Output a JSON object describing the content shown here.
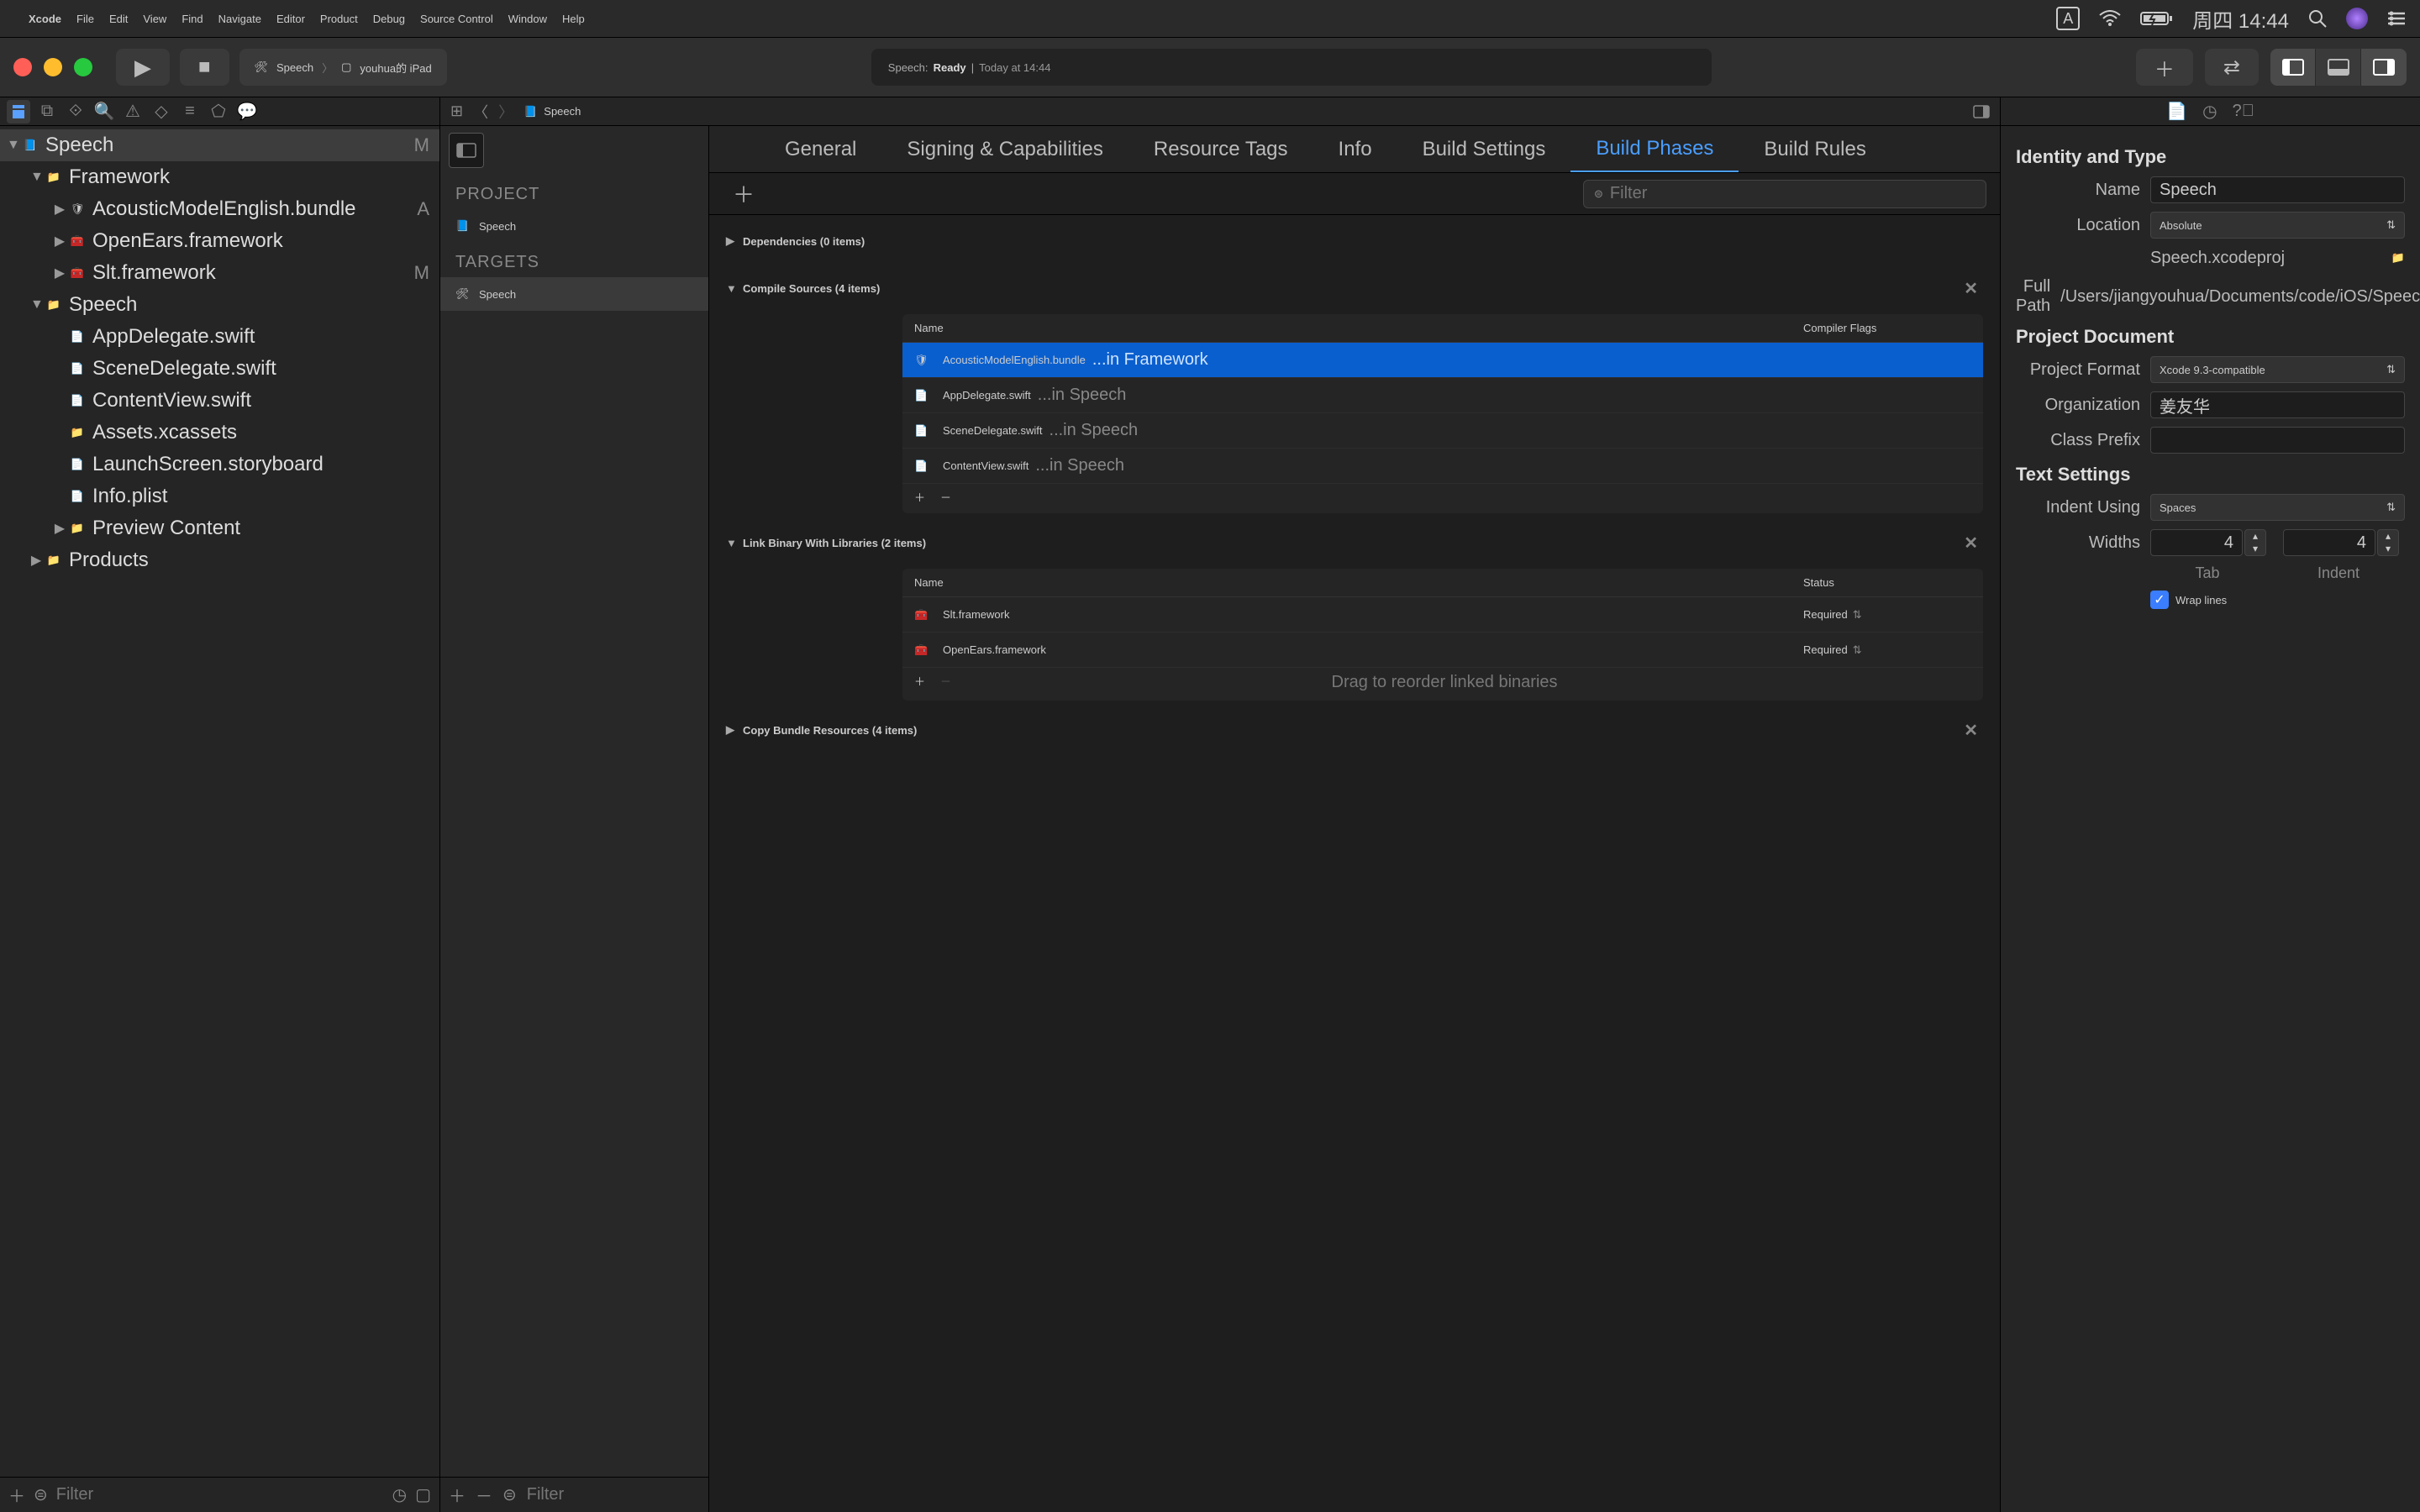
{
  "menubar": {
    "app": "Xcode",
    "items": [
      "File",
      "Edit",
      "View",
      "Find",
      "Navigate",
      "Editor",
      "Product",
      "Debug",
      "Source Control",
      "Window",
      "Help"
    ],
    "clock": "周四 14:44"
  },
  "toolbar": {
    "scheme_app": "Speech",
    "scheme_device": "youhua的 iPad",
    "status_prefix": "Speech:",
    "status_ready": "Ready",
    "status_sep": "|",
    "status_time": "Today at 14:44"
  },
  "navigator": {
    "root": {
      "name": "Speech",
      "badge": "M"
    },
    "tree": [
      {
        "indent": 1,
        "arrow": "▼",
        "icon": "folder",
        "name": "Framework"
      },
      {
        "indent": 2,
        "arrow": "▶",
        "icon": "bundle",
        "name": "AcousticModelEnglish.bundle",
        "badge": "A"
      },
      {
        "indent": 2,
        "arrow": "▶",
        "icon": "fw",
        "name": "OpenEars.framework"
      },
      {
        "indent": 2,
        "arrow": "▶",
        "icon": "fw",
        "name": "Slt.framework",
        "badge": "M"
      },
      {
        "indent": 1,
        "arrow": "▼",
        "icon": "folder",
        "name": "Speech"
      },
      {
        "indent": 2,
        "arrow": "",
        "icon": "swift",
        "name": "AppDelegate.swift"
      },
      {
        "indent": 2,
        "arrow": "",
        "icon": "swift",
        "name": "SceneDelegate.swift"
      },
      {
        "indent": 2,
        "arrow": "",
        "icon": "swift",
        "name": "ContentView.swift"
      },
      {
        "indent": 2,
        "arrow": "",
        "icon": "assets",
        "name": "Assets.xcassets"
      },
      {
        "indent": 2,
        "arrow": "",
        "icon": "storyboard",
        "name": "LaunchScreen.storyboard"
      },
      {
        "indent": 2,
        "arrow": "",
        "icon": "plist",
        "name": "Info.plist"
      },
      {
        "indent": 2,
        "arrow": "▶",
        "icon": "folder",
        "name": "Preview Content"
      },
      {
        "indent": 1,
        "arrow": "▶",
        "icon": "folder",
        "name": "Products"
      }
    ],
    "filter_placeholder": "Filter"
  },
  "jumpbar": {
    "breadcrumb": "Speech"
  },
  "targets": {
    "project_hdr": "PROJECT",
    "project": "Speech",
    "targets_hdr": "TARGETS",
    "target": "Speech"
  },
  "tabs": [
    "General",
    "Signing & Capabilities",
    "Resource Tags",
    "Info",
    "Build Settings",
    "Build Phases",
    "Build Rules"
  ],
  "active_tab": 5,
  "phase_filter_placeholder": "Filter",
  "phases": {
    "dependencies": {
      "title": "Dependencies (0 items)"
    },
    "compile": {
      "title": "Compile Sources (4 items)",
      "col1": "Name",
      "col2": "Compiler Flags",
      "rows": [
        {
          "file": "AcousticModelEnglish.bundle",
          "loc": "...in Framework",
          "sel": true,
          "icon": "bundle"
        },
        {
          "file": "AppDelegate.swift",
          "loc": "...in Speech",
          "icon": "swift"
        },
        {
          "file": "SceneDelegate.swift",
          "loc": "...in Speech",
          "icon": "swift"
        },
        {
          "file": "ContentView.swift",
          "loc": "...in Speech",
          "icon": "swift"
        }
      ]
    },
    "link": {
      "title": "Link Binary With Libraries (2 items)",
      "col1": "Name",
      "col2": "Status",
      "rows": [
        {
          "file": "Slt.framework",
          "status": "Required",
          "icon": "fw"
        },
        {
          "file": "OpenEars.framework",
          "status": "Required",
          "icon": "fw"
        }
      ],
      "hint": "Drag to reorder linked binaries"
    },
    "copy": {
      "title": "Copy Bundle Resources (4 items)"
    }
  },
  "inspector": {
    "identity_hdr": "Identity and Type",
    "name_lbl": "Name",
    "name_val": "Speech",
    "location_lbl": "Location",
    "location_val": "Absolute",
    "location_file": "Speech.xcodeproj",
    "fullpath_lbl": "Full Path",
    "fullpath_val": "/Users/jiangyouhua/Documents/code/iOS/Speech/Speech.xcodeproj",
    "projdoc_hdr": "Project Document",
    "format_lbl": "Project Format",
    "format_val": "Xcode 9.3-compatible",
    "org_lbl": "Organization",
    "org_val": "姜友华",
    "prefix_lbl": "Class Prefix",
    "prefix_val": "",
    "text_hdr": "Text Settings",
    "indent_lbl": "Indent Using",
    "indent_val": "Spaces",
    "widths_lbl": "Widths",
    "tab_val": "4",
    "indent_valn": "4",
    "tab_sub": "Tab",
    "indent_sub": "Indent",
    "wrap": "Wrap lines"
  },
  "editor_footer": {
    "filter_placeholder": "Filter"
  }
}
